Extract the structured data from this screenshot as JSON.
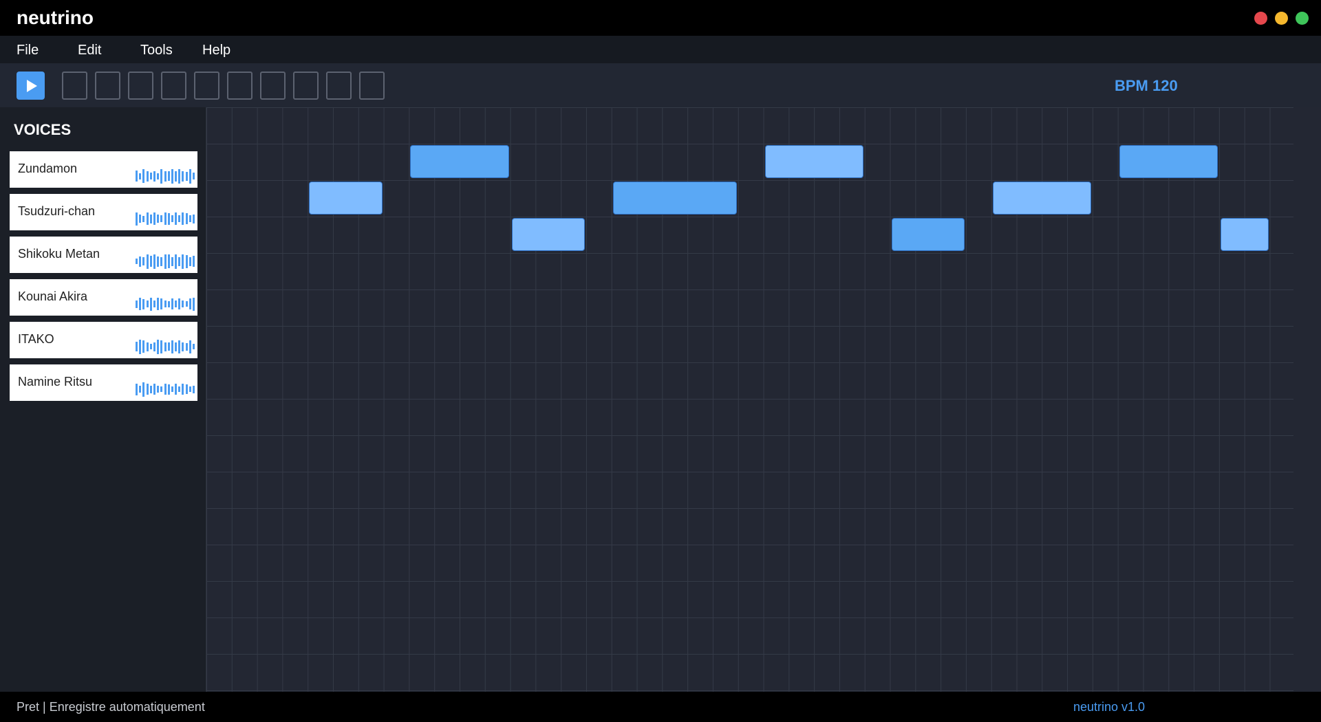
{
  "app": {
    "title": "neutrino"
  },
  "window_controls": [
    {
      "name": "close",
      "color": "#e5484d"
    },
    {
      "name": "minimize",
      "color": "#f5b82e"
    },
    {
      "name": "maximize",
      "color": "#3fc55a"
    }
  ],
  "menu": {
    "items": [
      {
        "label": "File"
      },
      {
        "label": "Edit"
      },
      {
        "label": "Tools"
      },
      {
        "label": "Help"
      }
    ]
  },
  "toolbar": {
    "play_icon": "play-icon",
    "bpm_label": "BPM 120",
    "tool_slot_count": 10
  },
  "sidebar": {
    "title": "VOICES",
    "voices": [
      {
        "name": "Zundamon",
        "icon": "waveform-icon"
      },
      {
        "name": "Tsudzuri-chan",
        "icon": "waveform-icon"
      },
      {
        "name": "Shikoku Metan",
        "icon": "waveform-icon"
      },
      {
        "name": "Kounai Akira",
        "icon": "waveform-icon"
      },
      {
        "name": "ITAKO",
        "icon": "waveform-icon"
      },
      {
        "name": "Namine Ritsu",
        "icon": "waveform-icon"
      }
    ]
  },
  "piano_roll": {
    "notes": [
      {
        "row": 1,
        "start": 8,
        "length": 4,
        "shade": "dark"
      },
      {
        "row": 1,
        "start": 22,
        "length": 4,
        "shade": "light"
      },
      {
        "row": 1,
        "start": 36,
        "length": 4,
        "shade": "dark"
      },
      {
        "row": 2,
        "start": 4,
        "length": 3,
        "shade": "light"
      },
      {
        "row": 2,
        "start": 16,
        "length": 5,
        "shade": "dark"
      },
      {
        "row": 2,
        "start": 31,
        "length": 4,
        "shade": "light"
      },
      {
        "row": 3,
        "start": 12,
        "length": 3,
        "shade": "light"
      },
      {
        "row": 3,
        "start": 27,
        "length": 3,
        "shade": "dark"
      },
      {
        "row": 3,
        "start": 40,
        "length": 2,
        "shade": "light"
      }
    ]
  },
  "status": {
    "left": "Pret  |  Enregistre automatiquement",
    "right": "neutrino  v1.0"
  },
  "colors": {
    "accent": "#4a9cf2",
    "note_dark": "#5aa8f5",
    "note_light": "#80bcff",
    "waveform": "#4a9cf2"
  }
}
